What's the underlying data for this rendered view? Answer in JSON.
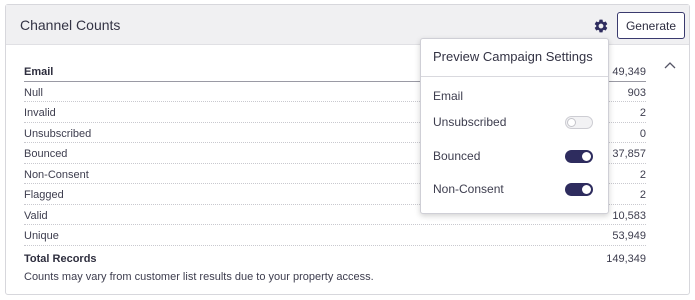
{
  "panel": {
    "title": "Channel Counts",
    "generate_label": "Generate",
    "icons": {
      "settings": "gear-icon",
      "collapse": "chevron-up-icon"
    }
  },
  "table": {
    "header": {
      "label": "Email",
      "value": "49,349"
    },
    "rows": [
      {
        "label": "Null",
        "value": "903"
      },
      {
        "label": "Invalid",
        "value": "2"
      },
      {
        "label": "Unsubscribed",
        "value": "0"
      },
      {
        "label": "Bounced",
        "value": "37,857"
      },
      {
        "label": "Non-Consent",
        "value": "2"
      },
      {
        "label": "Flagged",
        "value": "2"
      },
      {
        "label": "Valid",
        "value": "10,583"
      },
      {
        "label": "Unique",
        "value": "53,949"
      }
    ],
    "total": {
      "label": "Total Records",
      "value": "149,349"
    }
  },
  "note": "Counts may vary from customer list results due to your property access.",
  "popover": {
    "title": "Preview Campaign Settings",
    "section": "Email",
    "toggles": [
      {
        "label": "Unsubscribed",
        "on": false
      },
      {
        "label": "Bounced",
        "on": true
      },
      {
        "label": "Non-Consent",
        "on": true
      }
    ]
  },
  "colors": {
    "accent": "#2e2c5e",
    "header_bg": "#f0f0f2",
    "border": "#d7d7dc"
  }
}
